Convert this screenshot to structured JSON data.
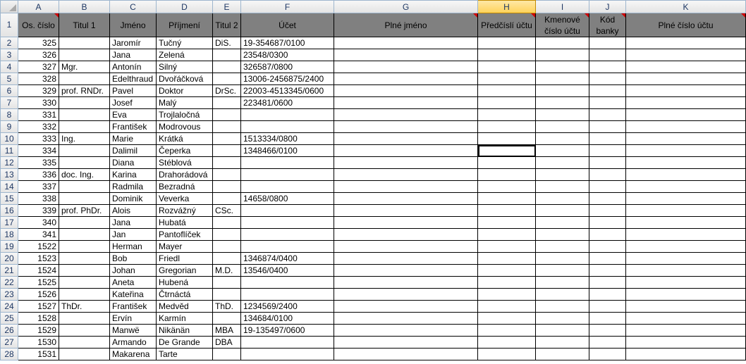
{
  "columns": [
    "A",
    "B",
    "C",
    "D",
    "E",
    "F",
    "G",
    "H",
    "I",
    "J",
    "K"
  ],
  "active_column_index": 7,
  "selected_cell": {
    "row_index": 10,
    "col_index": 7
  },
  "row_numbers": [
    1,
    2,
    3,
    4,
    5,
    6,
    7,
    8,
    9,
    10,
    11,
    12,
    13,
    14,
    15,
    16,
    17,
    18,
    19,
    20,
    21,
    22,
    23,
    24,
    25,
    26,
    27,
    28
  ],
  "headers": [
    {
      "label": "Os. číslo",
      "comment": true
    },
    {
      "label": "Titul 1",
      "comment": false
    },
    {
      "label": "Jméno",
      "comment": false
    },
    {
      "label": "Příjmení",
      "comment": false
    },
    {
      "label": "Titul 2",
      "comment": false
    },
    {
      "label": "Účet",
      "comment": false
    },
    {
      "label": "Plné jméno",
      "comment": true
    },
    {
      "label": "Předčíslí účtu",
      "comment": true
    },
    {
      "label": "Kmenové číslo účtu",
      "comment": true
    },
    {
      "label": "Kód banky",
      "comment": true
    },
    {
      "label": "Plné číslo účtu",
      "comment": true
    }
  ],
  "rows": [
    {
      "A": "325",
      "B": "",
      "C": "Jaromír",
      "D": "Tučný",
      "E": "DiS.",
      "F": "19-354687/0100",
      "G": "",
      "H": "",
      "I": "",
      "J": "",
      "K": ""
    },
    {
      "A": "326",
      "B": "",
      "C": "Jana",
      "D": "Zelená",
      "E": "",
      "F": "23548/0300",
      "G": "",
      "H": "",
      "I": "",
      "J": "",
      "K": ""
    },
    {
      "A": "327",
      "B": "Mgr.",
      "C": "Antonín",
      "D": "Silný",
      "E": "",
      "F": "326587/0800",
      "G": "",
      "H": "",
      "I": "",
      "J": "",
      "K": ""
    },
    {
      "A": "328",
      "B": "",
      "C": "Edelthraud",
      "D": "Dvořáčková",
      "E": "",
      "F": "13006-2456875/2400",
      "G": "",
      "H": "",
      "I": "",
      "J": "",
      "K": ""
    },
    {
      "A": "329",
      "B": "prof. RNDr.",
      "C": "Pavel",
      "D": "Doktor",
      "E": "DrSc.",
      "F": "22003-4513345/0600",
      "G": "",
      "H": "",
      "I": "",
      "J": "",
      "K": ""
    },
    {
      "A": "330",
      "B": "",
      "C": "Josef",
      "D": "Malý",
      "E": "",
      "F": "223481/0600",
      "G": "",
      "H": "",
      "I": "",
      "J": "",
      "K": ""
    },
    {
      "A": "331",
      "B": "",
      "C": "Eva",
      "D": "Trojlaločná",
      "E": "",
      "F": "",
      "G": "",
      "H": "",
      "I": "",
      "J": "",
      "K": ""
    },
    {
      "A": "332",
      "B": "",
      "C": "František",
      "D": "Modrovous",
      "E": "",
      "F": "",
      "G": "",
      "H": "",
      "I": "",
      "J": "",
      "K": ""
    },
    {
      "A": "333",
      "B": "Ing.",
      "C": "Marie",
      "D": "Krátká",
      "E": "",
      "F": "1513334/0800",
      "G": "",
      "H": "",
      "I": "",
      "J": "",
      "K": ""
    },
    {
      "A": "334",
      "B": "",
      "C": "Dalimil",
      "D": "Čeperka",
      "E": "",
      "F": "1348466/0100",
      "G": "",
      "H": "",
      "I": "",
      "J": "",
      "K": ""
    },
    {
      "A": "335",
      "B": "",
      "C": "Diana",
      "D": "Stéblová",
      "E": "",
      "F": "",
      "G": "",
      "H": "",
      "I": "",
      "J": "",
      "K": ""
    },
    {
      "A": "336",
      "B": "doc. Ing.",
      "C": "Karina",
      "D": "Drahorádová",
      "E": "",
      "F": "",
      "G": "",
      "H": "",
      "I": "",
      "J": "",
      "K": ""
    },
    {
      "A": "337",
      "B": "",
      "C": "Radmila",
      "D": "Bezradná",
      "E": "",
      "F": "",
      "G": "",
      "H": "",
      "I": "",
      "J": "",
      "K": ""
    },
    {
      "A": "338",
      "B": "",
      "C": "Dominik",
      "D": "Veverka",
      "E": "",
      "F": "14658/0800",
      "G": "",
      "H": "",
      "I": "",
      "J": "",
      "K": ""
    },
    {
      "A": "339",
      "B": "prof. PhDr.",
      "C": "Alois",
      "D": "Rozvážný",
      "E": "CSc.",
      "F": "",
      "G": "",
      "H": "",
      "I": "",
      "J": "",
      "K": ""
    },
    {
      "A": "340",
      "B": "",
      "C": "Jana",
      "D": "Hubatá",
      "E": "",
      "F": "",
      "G": "",
      "H": "",
      "I": "",
      "J": "",
      "K": ""
    },
    {
      "A": "341",
      "B": "",
      "C": "Jan",
      "D": "Pantoflíček",
      "E": "",
      "F": "",
      "G": "",
      "H": "",
      "I": "",
      "J": "",
      "K": ""
    },
    {
      "A": "1522",
      "B": "",
      "C": "Herman",
      "D": "Mayer",
      "E": "",
      "F": "",
      "G": "",
      "H": "",
      "I": "",
      "J": "",
      "K": ""
    },
    {
      "A": "1523",
      "B": "",
      "C": "Bob",
      "D": "Friedl",
      "E": "",
      "F": "1346874/0400",
      "G": "",
      "H": "",
      "I": "",
      "J": "",
      "K": ""
    },
    {
      "A": "1524",
      "B": "",
      "C": "Johan",
      "D": "Gregorian",
      "E": "M.D.",
      "F": "13546/0400",
      "G": "",
      "H": "",
      "I": "",
      "J": "",
      "K": ""
    },
    {
      "A": "1525",
      "B": "",
      "C": "Aneta",
      "D": "Hubená",
      "E": "",
      "F": "",
      "G": "",
      "H": "",
      "I": "",
      "J": "",
      "K": ""
    },
    {
      "A": "1526",
      "B": "",
      "C": "Kateřina",
      "D": "Čtrnáctá",
      "E": "",
      "F": "",
      "G": "",
      "H": "",
      "I": "",
      "J": "",
      "K": ""
    },
    {
      "A": "1527",
      "B": "ThDr.",
      "C": "František",
      "D": "Medvěd",
      "E": "ThD.",
      "F": "1234569/2400",
      "G": "",
      "H": "",
      "I": "",
      "J": "",
      "K": ""
    },
    {
      "A": "1528",
      "B": "",
      "C": "Ervín",
      "D": "Karmín",
      "E": "",
      "F": "134684/0100",
      "G": "",
      "H": "",
      "I": "",
      "J": "",
      "K": ""
    },
    {
      "A": "1529",
      "B": "",
      "C": "Manwë",
      "D": "Nikänän",
      "E": "MBA",
      "F": "19-135497/0600",
      "G": "",
      "H": "",
      "I": "",
      "J": "",
      "K": ""
    },
    {
      "A": "1530",
      "B": "",
      "C": "Armando",
      "D": "De Grande",
      "E": "DBA",
      "F": "",
      "G": "",
      "H": "",
      "I": "",
      "J": "",
      "K": ""
    },
    {
      "A": "1531",
      "B": "",
      "C": "Makarena",
      "D": "Tarte",
      "E": "",
      "F": "",
      "G": "",
      "H": "",
      "I": "",
      "J": "",
      "K": ""
    }
  ]
}
